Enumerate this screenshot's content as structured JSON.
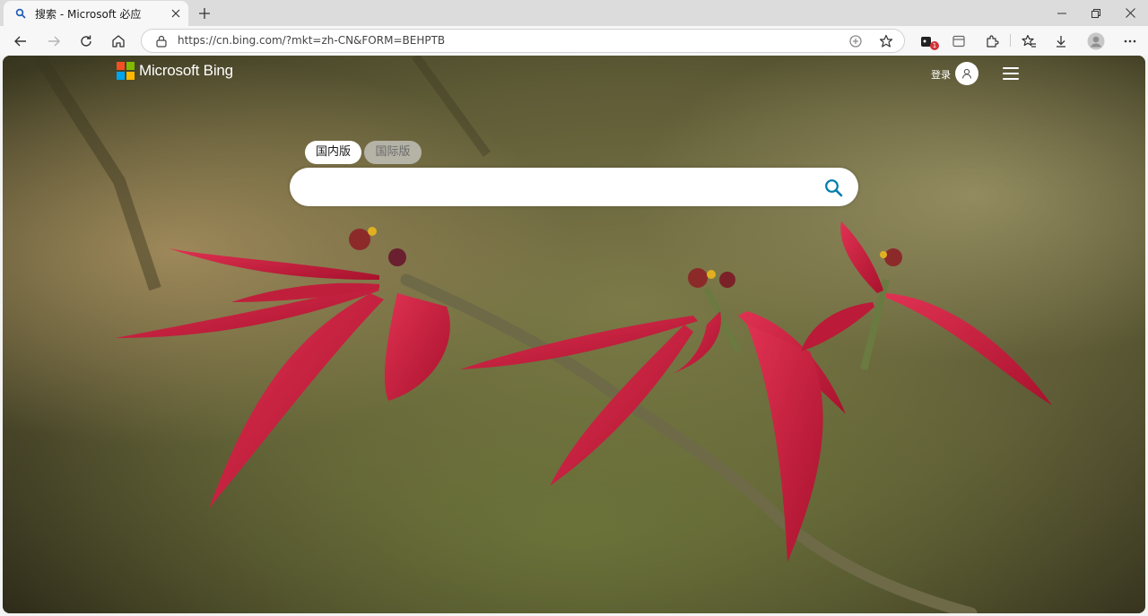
{
  "browser": {
    "tab_title": "搜索 - Microsoft 必应",
    "url": "https://cn.bing.com/?mkt=zh-CN&FORM=BEHPTB",
    "extensions_badge": "1"
  },
  "page": {
    "brand": "Microsoft Bing",
    "signin_label": "登录",
    "scopes": {
      "domestic": "国内版",
      "international": "国际版"
    },
    "search_placeholder": ""
  },
  "colors": {
    "bing_accent": "#007daa",
    "logo_red": "#f25022",
    "logo_green": "#7fba00",
    "logo_blue": "#00a4ef",
    "logo_yellow": "#ffb900"
  }
}
